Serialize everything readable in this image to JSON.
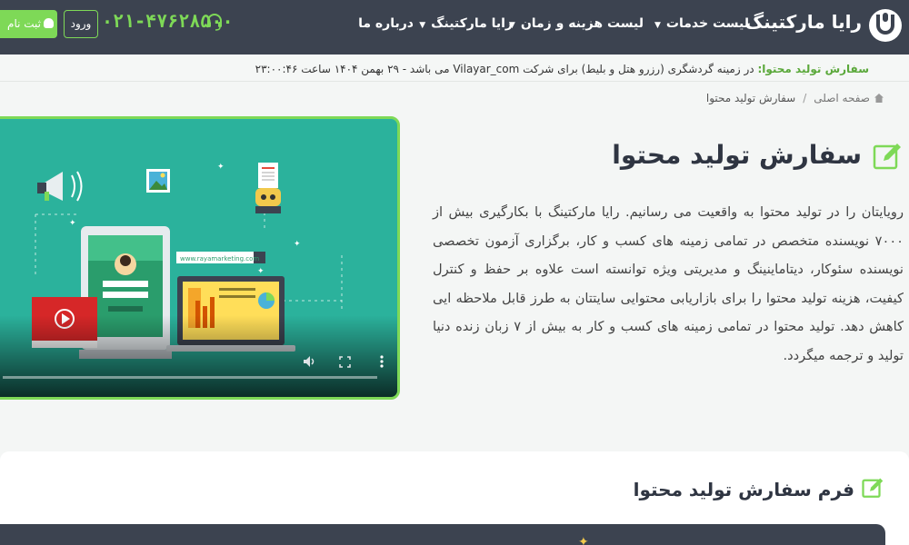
{
  "header": {
    "brand": "رایا مارکتینگ",
    "nav": [
      {
        "label": "لیست خدمات",
        "has_dropdown": true
      },
      {
        "label": "لیست هزینه و زمان",
        "has_dropdown": true
      },
      {
        "label": "رایا مارکتینگ",
        "has_dropdown": true
      },
      {
        "label": "درباره ما",
        "has_dropdown": false
      }
    ],
    "phone": "۰۲۱-۴۷۶۲۸۵۰۰",
    "login_label": "ورود",
    "register_label": "ثبت نام"
  },
  "ticker": {
    "label": "سفارش تولید محتوا:",
    "text": "در زمینه گردشگری (رزرو هتل و بلیط) برای شرکت Vilayar_com می باشد - ۲۹ بهمن ۱۴۰۴ ساعت ۲۳:۰۰:۴۶"
  },
  "breadcrumb": {
    "home": "صفحه اصلی",
    "separator": "/",
    "current": "سفارش تولید محتوا"
  },
  "main": {
    "title": "سفارش تولید محتوا",
    "description": "رویایتان را در تولید محتوا به واقعیت می رسانیم. رایا مارکتینگ با بکارگیری بیش از ۷۰۰۰ نویسنده متخصص در تمامی زمینه های کسب و کار، برگزاری آزمون تخصصی نویسنده سئوکار، دیتاماینینگ و مدیریتی ویژه توانسته است علاوه بر حفظ و کنترل کیفیت، هزینه تولید محتوا را برای بازاریابی محتوایی سایتتان به طرز قابل ملاحظه ایی کاهش دهد. تولید محتوا در تمامی زمینه های کسب و کار به بیش از ۷ زبان زنده دنیا تولید و ترجمه میگردد."
  },
  "video": {
    "site_url": "www.rayamarketing.com"
  },
  "form": {
    "title": "فرم سفارش تولید محتوا"
  },
  "colors": {
    "accent": "#7ed957",
    "header_bg": "#3c4350",
    "video_bg": "#2bb29c"
  },
  "icons": {
    "logo": "raya-logo-icon",
    "headset": "headset-icon",
    "user": "user-icon",
    "edit": "edit-icon",
    "home": "home-icon"
  }
}
